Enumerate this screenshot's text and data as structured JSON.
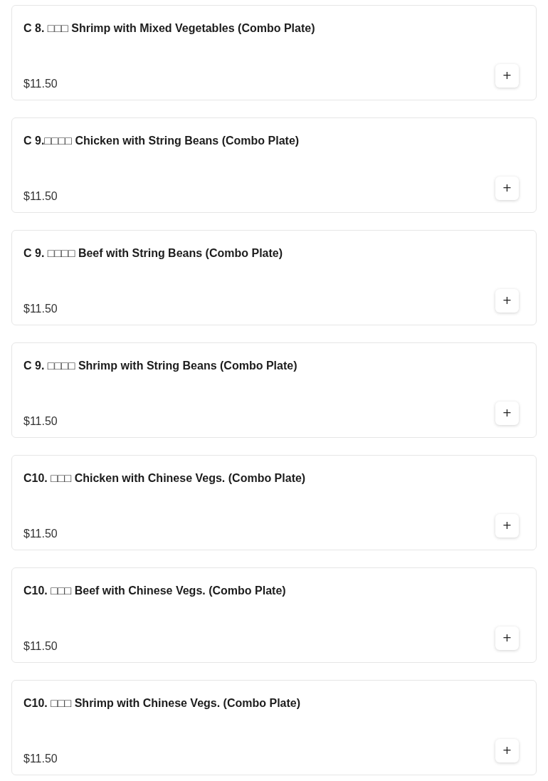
{
  "items": [
    {
      "name": "C 8. □□□ Shrimp with Mixed Vegetables (Combo Plate)",
      "price": "$11.50",
      "add_label": "+"
    },
    {
      "name": "C 9.□□□□ Chicken with String Beans (Combo Plate)",
      "price": "$11.50",
      "add_label": "+"
    },
    {
      "name": "C 9. □□□□ Beef with String Beans (Combo Plate)",
      "price": "$11.50",
      "add_label": "+"
    },
    {
      "name": "C 9. □□□□ Shrimp with String Beans (Combo Plate)",
      "price": "$11.50",
      "add_label": "+"
    },
    {
      "name": "C10. □□□ Chicken with Chinese Vegs. (Combo Plate)",
      "price": "$11.50",
      "add_label": "+"
    },
    {
      "name": "C10. □□□ Beef with Chinese Vegs. (Combo Plate)",
      "price": "$11.50",
      "add_label": "+"
    },
    {
      "name": "C10. □□□ Shrimp with Chinese Vegs. (Combo Plate)",
      "price": "$11.50",
      "add_label": "+"
    }
  ]
}
